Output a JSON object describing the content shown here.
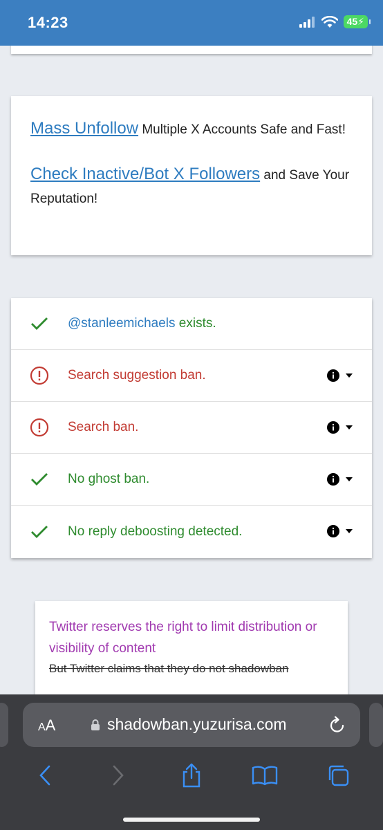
{
  "status": {
    "time": "14:23",
    "battery": "45"
  },
  "promo": {
    "line1": {
      "link": "Mass Unfollow",
      "rest": " Multiple X Accounts Safe and Fast!"
    },
    "line2": {
      "link": "Check Inactive/Bot X Followers",
      "rest": " and Save Your Reputation!"
    }
  },
  "results": {
    "exists": {
      "handle": "@stanleemichaels",
      "text": " exists."
    },
    "suggestion_ban": "Search suggestion ban.",
    "search_ban": "Search ban.",
    "ghost_ban": "No ghost ban.",
    "reply_deboosting": "No reply deboosting detected."
  },
  "notice": {
    "purple": "Twitter reserves the right to limit distribution or visibility of content",
    "strike": "But Twitter claims that they do not shadowban"
  },
  "browser": {
    "aa": "AA",
    "url": "shadowban.yuzurisa.com"
  },
  "colors": {
    "ok": "#2e8b2e",
    "bad": "#c23b33",
    "link": "#2e7cc0",
    "purple": "#a13ab0",
    "header": "#3c7fc1"
  }
}
